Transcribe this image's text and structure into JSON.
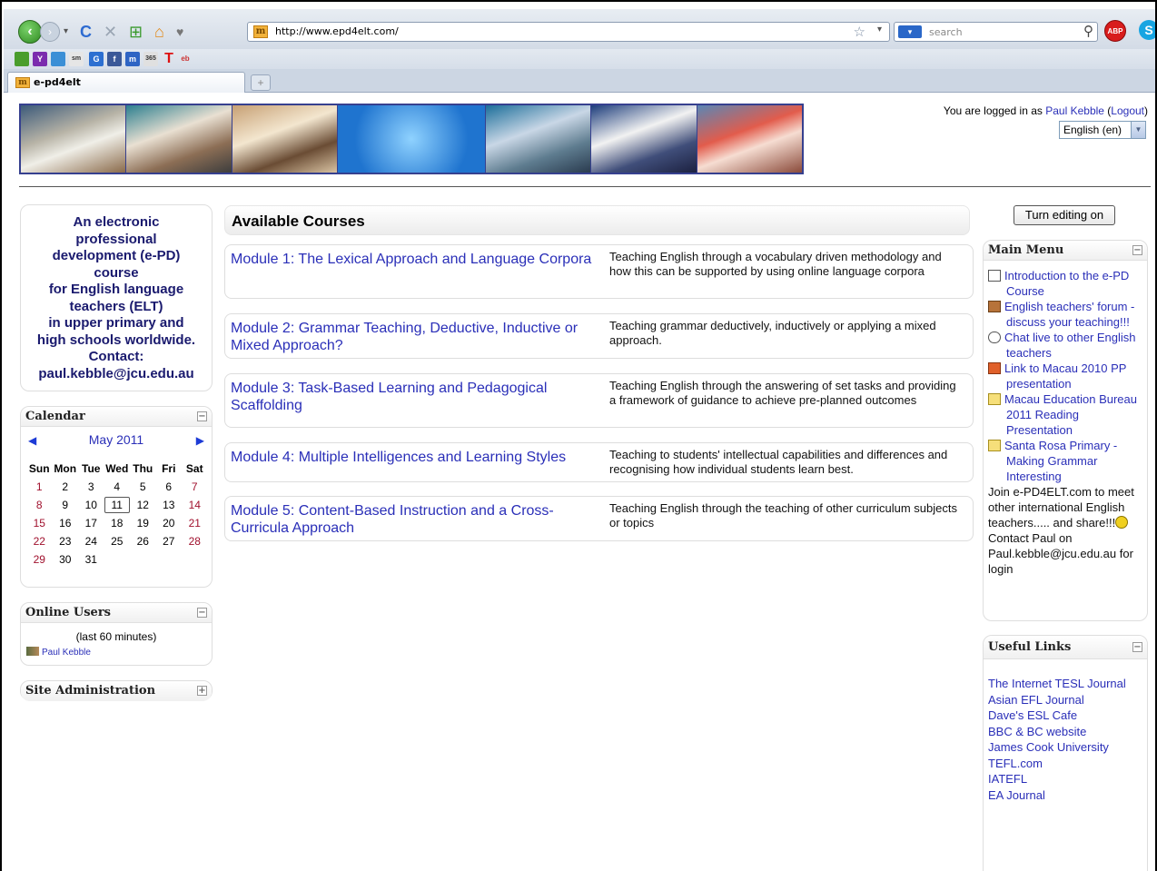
{
  "browser": {
    "url": "http://www.epd4elt.com/",
    "search_placeholder": "search",
    "tab_title": "e-pd4elt",
    "abp_label": "ABP",
    "new_tab": "+"
  },
  "header": {
    "logged_in_prefix": "You are logged in as ",
    "user_name": "Paul Kebble",
    "logout": "Logout",
    "language": "English (en)"
  },
  "intro": {
    "lines": [
      "An electronic",
      "professional",
      "development (e-PD)",
      "course",
      "for English language",
      "teachers (ELT)",
      "in upper primary and",
      "high schools worldwide.",
      "Contact:",
      "paul.kebble@jcu.edu.au"
    ]
  },
  "calendar": {
    "title": "Calendar",
    "month": "May 2011",
    "weekdays": [
      "Sun",
      "Mon",
      "Tue",
      "Wed",
      "Thu",
      "Fri",
      "Sat"
    ],
    "weeks": [
      [
        "1",
        "2",
        "3",
        "4",
        "5",
        "6",
        "7"
      ],
      [
        "8",
        "9",
        "10",
        "11",
        "12",
        "13",
        "14"
      ],
      [
        "15",
        "16",
        "17",
        "18",
        "19",
        "20",
        "21"
      ],
      [
        "22",
        "23",
        "24",
        "25",
        "26",
        "27",
        "28"
      ],
      [
        "29",
        "30",
        "31",
        "",
        "",
        "",
        ""
      ]
    ],
    "today": "11"
  },
  "online": {
    "title": "Online Users",
    "note": "(last 60 minutes)",
    "user": "Paul Kebble"
  },
  "site_admin": {
    "title": "Site Administration"
  },
  "courses": {
    "title": "Available Courses",
    "items": [
      {
        "name": "Module 1: The Lexical Approach and Language Corpora",
        "summary": "Teaching English through a vocabulary driven methodology and how this can be supported by using online language corpora"
      },
      {
        "name": "Module 2: Grammar Teaching, Deductive, Inductive or Mixed Approach?",
        "summary": "Teaching grammar deductively, inductively or applying a mixed approach."
      },
      {
        "name": "Module 3: Task-Based Learning and Pedagogical Scaffolding",
        "summary": "Teaching English through the answering of set tasks and providing a framework of guidance to achieve pre-planned outcomes"
      },
      {
        "name": "Module 4: Multiple Intelligences and Learning Styles",
        "summary": "Teaching to students' intellectual capabilities and differences and recognising how individual students learn best."
      },
      {
        "name": "Module 5: Content-Based Instruction and a Cross-Curricula Approach",
        "summary": "Teaching English through the teaching of other curriculum subjects or topics"
      }
    ]
  },
  "right": {
    "edit_button": "Turn editing on",
    "main_menu_title": "Main Menu",
    "menu": [
      "Introduction to the e-PD Course",
      "English teachers' forum - discuss your teaching!!!",
      "Chat live to other English teachers",
      "Link to Macau 2010 PP presentation",
      "Macau Education Bureau 2011 Reading Presentation",
      "Santa Rosa Primary - Making Grammar Interesting"
    ],
    "menu_text_1": "Join e-PD4ELT.com to meet other international English teachers..... and share!!!",
    "menu_text_2": " Contact Paul on Paul.kebble@jcu.edu.au for login",
    "useful_title": "Useful Links",
    "useful": [
      "The Internet TESL Journal",
      "Asian EFL Journal",
      "Dave's ESL Cafe",
      "BBC & BC website",
      "James Cook University",
      "TEFL.com",
      "IATEFL",
      "EA Journal"
    ]
  },
  "colors": {
    "link": "#2a2fb8",
    "weekend": "#a0102d",
    "banner_border": "#36408f"
  }
}
